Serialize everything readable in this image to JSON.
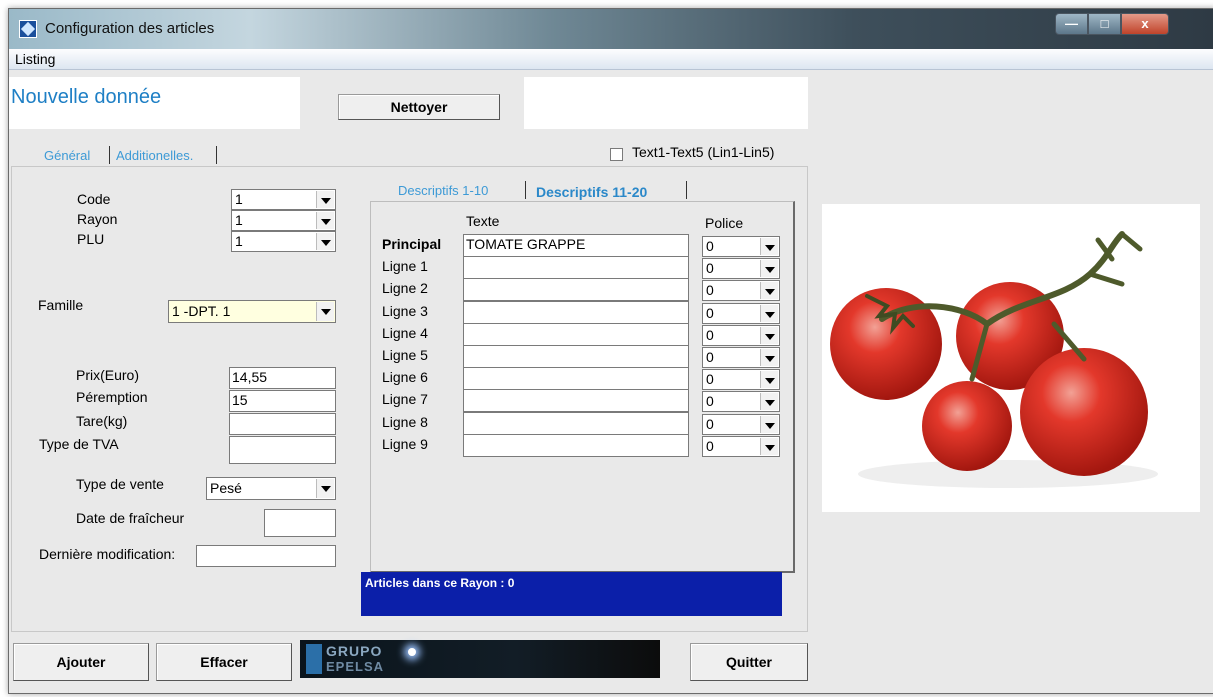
{
  "window": {
    "title": "Configuration des articles",
    "controls": {
      "minimize": "—",
      "maximize": "□",
      "close": "x"
    }
  },
  "menu": {
    "listing": "Listing"
  },
  "header": {
    "title": "Nouvelle donnée",
    "clean_button": "Nettoyer"
  },
  "tabs": {
    "general": "Général",
    "additional": "Additionelles."
  },
  "text_checkbox": {
    "label": "Text1-Text5 (Lin1-Lin5)",
    "checked": false
  },
  "general": {
    "code": {
      "label": "Code",
      "value": "1"
    },
    "rayon": {
      "label": "Rayon",
      "value": "1"
    },
    "plu": {
      "label": "PLU",
      "value": "1"
    },
    "famille": {
      "label": "Famille",
      "value": "1   -DPT. 1"
    },
    "prix": {
      "label": "Prix(Euro)",
      "value": "14,55"
    },
    "peremption": {
      "label": "Péremption",
      "value": "15"
    },
    "tare": {
      "label": "Tare(kg)",
      "value": ""
    },
    "tva": {
      "label": "Type de TVA",
      "value": ""
    },
    "type_vente": {
      "label": "Type de vente",
      "value": "Pesé"
    },
    "date_fraicheur": {
      "label": "Date de fraîcheur",
      "value": ""
    },
    "derniere_modif": {
      "label": "Dernière modification:",
      "value": ""
    }
  },
  "descriptifs": {
    "tab1": "Descriptifs 1-10",
    "tab2": "Descriptifs 11-20",
    "col_texte": "Texte",
    "col_police": "Police",
    "rows": [
      {
        "label": "Principal",
        "text": "TOMATE GRAPPE",
        "police": "0"
      },
      {
        "label": "Ligne 1",
        "text": "",
        "police": "0"
      },
      {
        "label": "Ligne 2",
        "text": "",
        "police": "0"
      },
      {
        "label": "Ligne 3",
        "text": "",
        "police": "0"
      },
      {
        "label": "Ligne 4",
        "text": "",
        "police": "0"
      },
      {
        "label": "Ligne 5",
        "text": "",
        "police": "0"
      },
      {
        "label": "Ligne 6",
        "text": "",
        "police": "0"
      },
      {
        "label": "Ligne 7",
        "text": "",
        "police": "0"
      },
      {
        "label": "Ligne 8",
        "text": "",
        "police": "0"
      },
      {
        "label": "Ligne 9",
        "text": "",
        "police": "0"
      }
    ]
  },
  "status": {
    "text": "Articles dans ce Rayon : 0"
  },
  "footer": {
    "add": "Ajouter",
    "delete": "Effacer",
    "quit": "Quitter"
  },
  "logo": {
    "line1": "GRUPO",
    "line2": "EPELSA"
  },
  "colors": {
    "accent_blue": "#1e7fc5",
    "status_blue": "#0b1fa9",
    "famille_bg": "#ffffe0"
  }
}
